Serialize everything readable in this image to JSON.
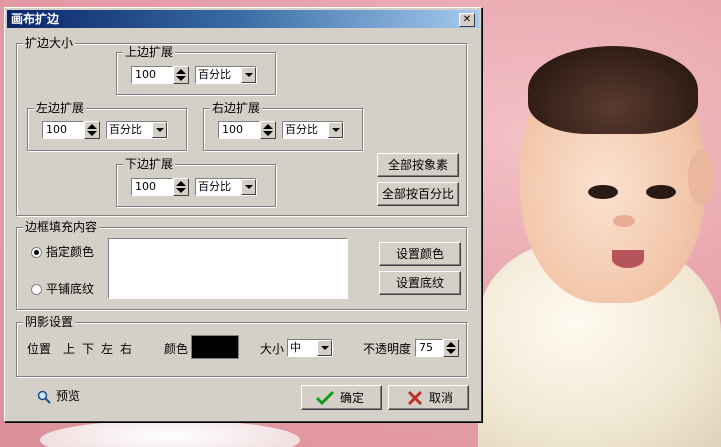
{
  "dialog": {
    "title": "画布扩边",
    "close_glyph": "✕"
  },
  "expand": {
    "legend": "扩边大小",
    "top": {
      "label": "上边扩展",
      "value": "100",
      "unit": "百分比"
    },
    "left": {
      "label": "左边扩展",
      "value": "100",
      "unit": "百分比"
    },
    "right": {
      "label": "右边扩展",
      "value": "100",
      "unit": "百分比"
    },
    "bottom": {
      "label": "下边扩展",
      "value": "100",
      "unit": "百分比"
    },
    "all_pixels_button": "全部按象素",
    "all_percent_button": "全部按百分比"
  },
  "fill": {
    "legend": "边框填充内容",
    "option_color": "指定颜色",
    "option_texture": "平铺底纹",
    "selected": "option_color",
    "set_color_button": "设置颜色",
    "set_texture_button": "设置底纹",
    "preview_color": "#ffffff"
  },
  "shadow": {
    "legend": "阴影设置",
    "position_label": "位置",
    "positions": [
      "上",
      "下",
      "左",
      "右"
    ],
    "color_label": "颜色",
    "color_value": "#000000",
    "size_label": "大小",
    "size_value": "中",
    "opacity_label": "不透明度",
    "opacity_value": "75"
  },
  "footer": {
    "preview_label": "预览",
    "ok_label": "确定",
    "cancel_label": "取消"
  },
  "icons": {
    "preview": "magnifier-icon",
    "ok": "checkmark-icon",
    "cancel": "x-icon"
  },
  "colors": {
    "ok_check": "#1a9a1a",
    "cancel_x": "#c0302a"
  }
}
